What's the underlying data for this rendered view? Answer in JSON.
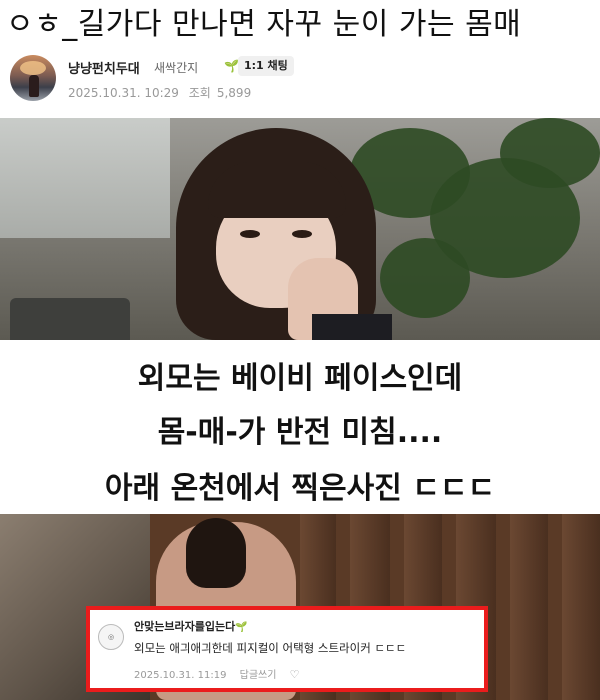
{
  "post": {
    "title": "ㅇㅎ_길가다 만나면 자꾸 눈이 가는 몸매",
    "author": {
      "nickname": "냥냥펀치두대",
      "grade": "새싹간지",
      "grade_icon": "sprout-icon",
      "chat_label": "1:1 채팅"
    },
    "date": "2025.10.31. 10:29",
    "views_label": "조회",
    "views": "5,899"
  },
  "caption": {
    "line1": "외모는 베이비 페이스인데",
    "line2": "몸-매-가 반전 미침....",
    "line3": "아래 온천에서 찍은사진 ㄷㄷㄷ"
  },
  "comment": {
    "nickname": "안맞는브라자를입는다",
    "grade_icon": "sprout-icon",
    "text": "외모는 애긔애긔한데 피지컬이 어택형 스트라이커 ㄷㄷㄷ",
    "date": "2025.10.31. 11:19",
    "reply_label": "답글쓰기",
    "like_icon": "heart-outline-icon",
    "highlight_color": "#ea1c1c"
  }
}
